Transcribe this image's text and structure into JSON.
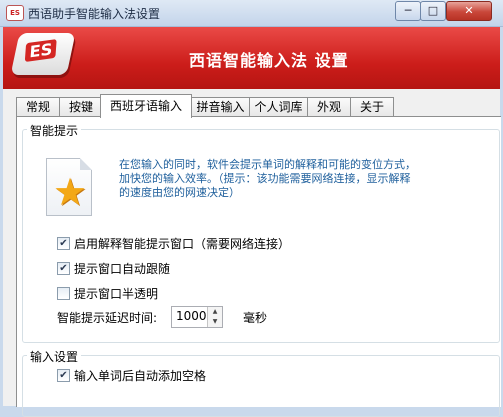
{
  "window": {
    "title": "西语助手智能输入法设置",
    "minimize_glyph": "─",
    "maximize_glyph": "□",
    "close_glyph": "✕"
  },
  "banner": {
    "logo_text": "ES",
    "title": "西语智能输入法 设置"
  },
  "tabs": [
    {
      "label": "常规"
    },
    {
      "label": "按键"
    },
    {
      "label": "西班牙语输入",
      "active": true
    },
    {
      "label": "拼音输入"
    },
    {
      "label": "个人词库"
    },
    {
      "label": "外观"
    },
    {
      "label": "关于"
    }
  ],
  "smart_hint": {
    "group_title": "智能提示",
    "description": "在您输入的同时，软件会提示单词的解释和可能的变位方式，加快您的输入效率。（提示：该功能需要网络连接，显示解释的速度由您的网速决定）",
    "options": [
      {
        "label": "启用解释智能提示窗口（需要网络连接）",
        "checked": true
      },
      {
        "label": "提示窗口自动跟随",
        "checked": true
      },
      {
        "label": "提示窗口半透明",
        "checked": false
      }
    ],
    "delay_label": "智能提示延迟时间:",
    "delay_value": "1000",
    "delay_unit": "毫秒"
  },
  "input_settings": {
    "group_title": "输入设置",
    "options": [
      {
        "label": "输入单词后自动添加空格",
        "checked": true
      }
    ]
  },
  "icons": {
    "app": "es-app-icon",
    "document_star": "document-star-icon"
  },
  "colors": {
    "banner_red": "#cc1d1a",
    "hint_text": "#1e5f9c"
  }
}
